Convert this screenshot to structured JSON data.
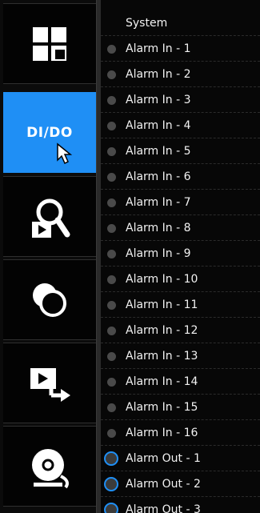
{
  "sidebar": {
    "items": [
      {
        "name": "dashboard",
        "icon": "layout-grid-icon"
      },
      {
        "name": "di-do",
        "label": "DI/DO",
        "active": true
      },
      {
        "name": "search",
        "icon": "search-playback-icon"
      },
      {
        "name": "event",
        "icon": "overlap-circles-icon"
      },
      {
        "name": "export",
        "icon": "video-export-icon"
      },
      {
        "name": "alarm",
        "icon": "alarm-bell-icon"
      }
    ]
  },
  "list": {
    "header": "System",
    "alarm_in": [
      "Alarm In - 1",
      "Alarm In - 2",
      "Alarm In - 3",
      "Alarm In - 4",
      "Alarm In - 5",
      "Alarm In - 6",
      "Alarm In - 7",
      "Alarm In - 8",
      "Alarm In - 9",
      "Alarm In - 10",
      "Alarm In - 11",
      "Alarm In - 12",
      "Alarm In - 13",
      "Alarm In - 14",
      "Alarm In - 15",
      "Alarm In - 16"
    ],
    "alarm_out": [
      "Alarm Out - 1",
      "Alarm Out - 2",
      "Alarm Out - 3"
    ]
  },
  "colors": {
    "accent": "#1f8ff5",
    "indicator_off": "#4a4a4a"
  }
}
